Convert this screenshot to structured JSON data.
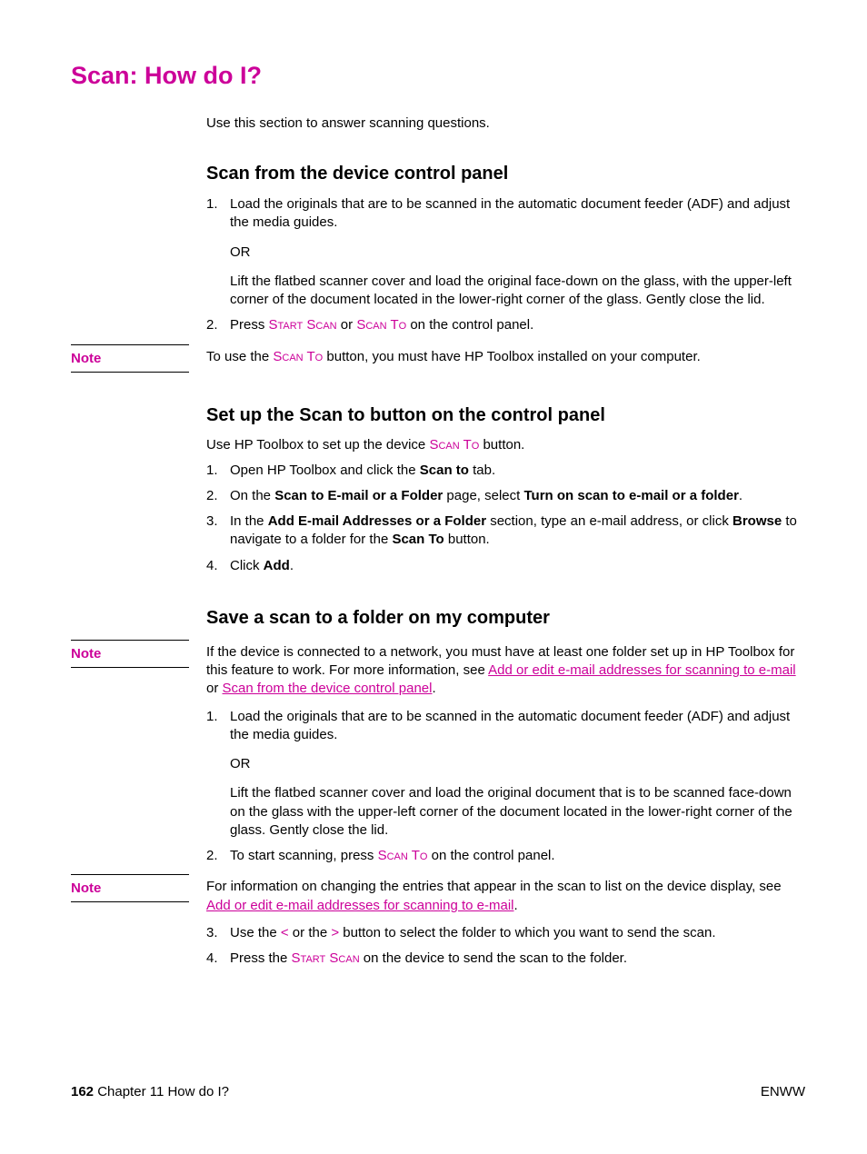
{
  "title": "Scan: How do I?",
  "intro": "Use this section to answer scanning questions.",
  "section1": {
    "heading": "Scan from the device control panel",
    "item1_a": "Load the originals that are to be scanned in the automatic document feeder (ADF) and adjust the media guides.",
    "or": "OR",
    "item1_b": "Lift the flatbed scanner cover and load the original face-down on the glass, with the upper-left corner of the document located in the lower-right corner of the glass. Gently close the lid.",
    "item2_prefix": "Press ",
    "start_scan": "Start Scan",
    "or_word": " or ",
    "scan_to": "Scan To",
    "item2_suffix": " on the control panel."
  },
  "note1": {
    "label": "Note",
    "prefix": "To use the ",
    "scan_to": "Scan To",
    "suffix": " button, you must have HP Toolbox installed on your computer."
  },
  "section2": {
    "heading": "Set up the Scan to button on the control panel",
    "intro_prefix": "Use HP Toolbox to set up the device ",
    "scan_to": "Scan To",
    "intro_suffix": " button.",
    "item1_a": "Open HP Toolbox and click the ",
    "item1_b": "Scan to",
    "item1_c": " tab.",
    "item2_a": "On the ",
    "item2_b": "Scan to E-mail or a Folder",
    "item2_c": " page, select ",
    "item2_d": "Turn on scan to e-mail or a folder",
    "item2_e": ".",
    "item3_a": "In the ",
    "item3_b": "Add E-mail Addresses or a Folder",
    "item3_c": " section, type an e-mail address, or click ",
    "item3_d": "Browse",
    "item3_e": " to navigate to a folder for the ",
    "item3_f": "Scan To",
    "item3_g": " button.",
    "item4_a": "Click ",
    "item4_b": "Add",
    "item4_c": "."
  },
  "section3": {
    "heading": "Save a scan to a folder on my computer"
  },
  "note2": {
    "label": "Note",
    "a": "If the device is connected to a network, you must have at least one folder set up in HP Toolbox for this feature to work. For more information, see ",
    "link1": "Add or edit e-mail addresses for scanning to e-mail",
    "b": " or ",
    "link2": "Scan from the device control panel",
    "c": "."
  },
  "section3_list": {
    "item1_a": "Load the originals that are to be scanned in the automatic document feeder (ADF) and adjust the media guides.",
    "or": "OR",
    "item1_b": "Lift the flatbed scanner cover and load the original document that is to be scanned face-down on the glass with the upper-left corner of the document located in the lower-right corner of the glass. Gently close the lid.",
    "item2_a": "To start scanning, press ",
    "scan_to": "Scan To",
    "item2_b": " on the control panel."
  },
  "note3": {
    "label": "Note",
    "a": "For information on changing the entries that appear in the scan to list on the device display, see ",
    "link": "Add or edit e-mail addresses for scanning to e-mail",
    "b": "."
  },
  "section3_list2": {
    "item3_a": "Use the ",
    "lt": "<",
    "item3_b": " or the ",
    "gt": ">",
    "item3_c": " button to select the folder to which you want to send the scan.",
    "item4_a": "Press the ",
    "start_scan": "Start Scan",
    "item4_b": " on the device to send the scan to the folder."
  },
  "footer": {
    "page": "162",
    "chapter": "   Chapter 11  How do I?",
    "right": "ENWW"
  },
  "nums": {
    "n1": "1.",
    "n2": "2.",
    "n3": "3.",
    "n4": "4."
  }
}
